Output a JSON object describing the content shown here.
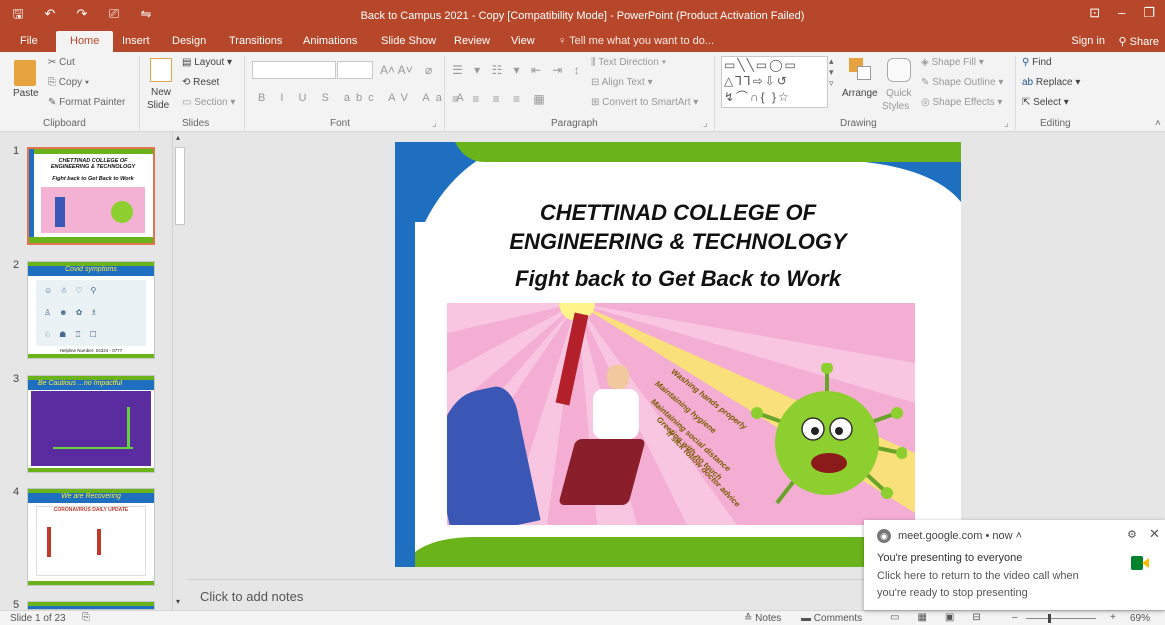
{
  "window": {
    "title": "Back to Campus 2021 - Copy [Compatibility Mode] - PowerPoint (Product Activation Failed)"
  },
  "menu": {
    "tabs": [
      "File",
      "Home",
      "Insert",
      "Design",
      "Transitions",
      "Animations",
      "Slide Show",
      "Review",
      "View"
    ],
    "active_tab": "Home",
    "tell_me": "Tell me what you want to do...",
    "sign_in": "Sign in",
    "share": "Share"
  },
  "ribbon": {
    "clipboard": {
      "label": "Clipboard",
      "paste": "Paste",
      "cut": "Cut",
      "copy": "Copy",
      "format_painter": "Format Painter"
    },
    "slides": {
      "label": "Slides",
      "new_slide_1": "New",
      "new_slide_2": "Slide",
      "layout": "Layout",
      "reset": "Reset",
      "section": "Section"
    },
    "font": {
      "label": "Font"
    },
    "paragraph": {
      "label": "Paragraph",
      "text_direction": "Text Direction",
      "align_text": "Align Text",
      "convert_smartart": "Convert to SmartArt"
    },
    "drawing": {
      "label": "Drawing",
      "arrange": "Arrange",
      "quick_styles_1": "Quick",
      "quick_styles_2": "Styles",
      "shape_fill": "Shape Fill",
      "shape_outline": "Shape Outline",
      "shape_effects": "Shape Effects"
    },
    "editing": {
      "label": "Editing",
      "find": "Find",
      "replace": "Replace",
      "select": "Select"
    }
  },
  "thumbnails": [
    {
      "num": "1",
      "title": "CHETTINAD COLLEGE OF ENGINEERING & TECHNOLOGY",
      "subtitle": "Fight back to Get Back to Work"
    },
    {
      "num": "2",
      "title": "Covid symptoms",
      "footer": "Helpline Number: 04324 - 0777"
    },
    {
      "num": "3",
      "title": "Be Cautious ...no Impactful"
    },
    {
      "num": "4",
      "title": "We are Recovering",
      "sub": "CORONAVIRUS DAILY UPDATE"
    },
    {
      "num": "5"
    }
  ],
  "slide": {
    "title_line1": "CHETTINAD COLLEGE OF",
    "title_line2": "ENGINEERING & TECHNOLOGY",
    "subtitle": "Fight back to Get Back to Work",
    "rays": [
      "Washing hands properly",
      "Maintaining hygiene",
      "Maintaining social distance",
      "Greeting with no touch",
      "If sick follow doctor advice"
    ]
  },
  "notes": {
    "placeholder": "Click to add notes"
  },
  "status": {
    "slide_of": "Slide 1 of 23",
    "notes_btn": "Notes",
    "comments_btn": "Comments",
    "zoom": "69%"
  },
  "toast": {
    "source": "meet.google.com",
    "time": "now",
    "line1": "You're presenting to everyone",
    "line2": "Click here to return to the video call when",
    "line3": "you're ready to stop presenting"
  },
  "colors": {
    "accent": "#b7472a",
    "slide_green": "#6bb31b",
    "slide_blue": "#1f6fc1",
    "selection": "#e2754f"
  }
}
